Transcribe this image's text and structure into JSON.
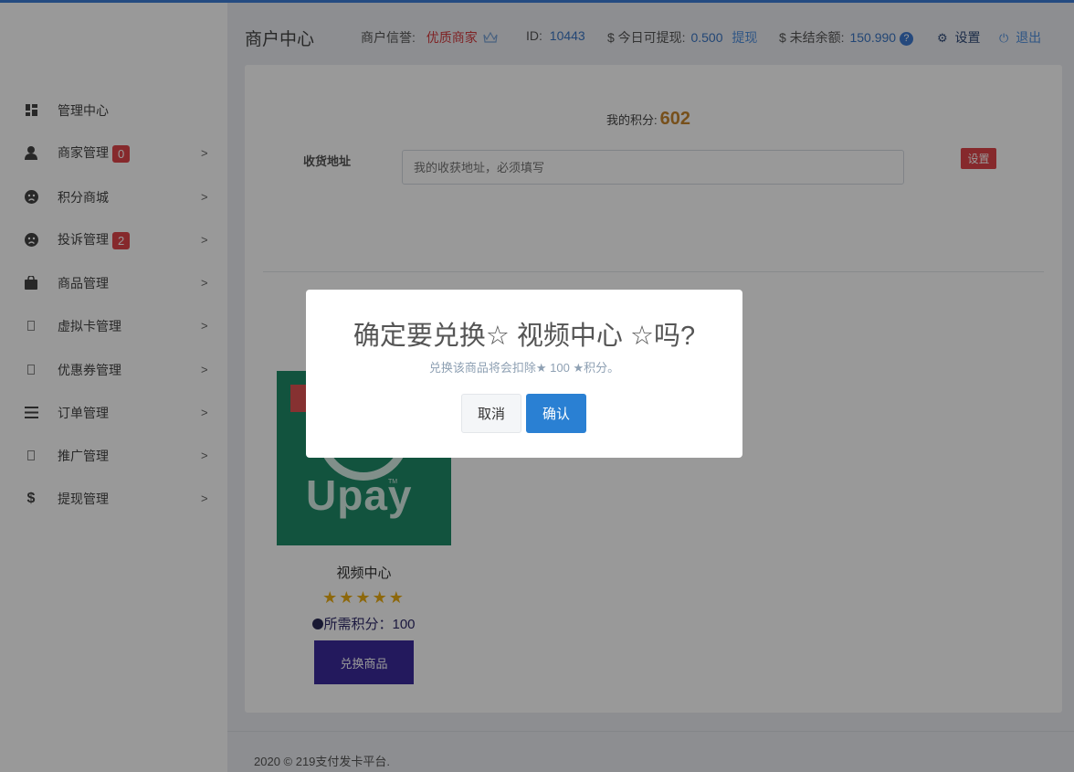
{
  "header": {
    "title": "商户中心",
    "credit_label": "商户信誉:",
    "credit_value": "优质商家",
    "id_label": "ID:",
    "id_value": "10443",
    "withdraw_label": "$ 今日可提现:",
    "withdraw_value": "0.500",
    "withdraw_link": "提现",
    "unsettled_label": "$ 未结余额:",
    "unsettled_value": "150.990",
    "help_mark": "?",
    "settings": "设置",
    "logout": "退出",
    "icons": [
      "crown-icon",
      "gear-icon",
      "power-icon"
    ]
  },
  "sidebar": {
    "items": [
      {
        "label": "管理中心",
        "icon": "dashboard-icon"
      },
      {
        "label": "商家管理",
        "icon": "user-icon",
        "badge": "0"
      },
      {
        "label": "积分商城",
        "icon": "frown-icon"
      },
      {
        "label": "投诉管理",
        "icon": "frown-icon",
        "badge": "2"
      },
      {
        "label": "商品管理",
        "icon": "bag-icon"
      },
      {
        "label": "虚拟卡管理",
        "icon": "missing-icon"
      },
      {
        "label": "优惠券管理",
        "icon": "missing-icon"
      },
      {
        "label": "订单管理",
        "icon": "list-icon"
      },
      {
        "label": "推广管理",
        "icon": "missing-icon"
      },
      {
        "label": "提现管理",
        "icon": "dollar-icon"
      }
    ]
  },
  "main": {
    "points_label": "我的积分:",
    "points_value": "602",
    "address_label": "收货地址",
    "address_placeholder": "我的收获地址，必须填写",
    "set_button": "设置",
    "product": {
      "image_text": "Upay",
      "name": "视频中心",
      "stars": "★★★★★",
      "rating": 5,
      "cost": "所需积分：100",
      "exchange_button": "兑换商品"
    }
  },
  "footer": {
    "text": "2020 © 219支付发卡平台."
  },
  "modal": {
    "title": "确定要兑换☆ 视频中心 ☆吗?",
    "subtitle": "兑换该商品将会扣除★ 100 ★积分。",
    "cancel": "取消",
    "confirm": "确认"
  },
  "colors": {
    "accent": "#2a80d3",
    "danger": "#e0454a",
    "points": "#c6862e",
    "exchange_button": "#3b2a9c",
    "product_bg": "#1e8a68"
  }
}
